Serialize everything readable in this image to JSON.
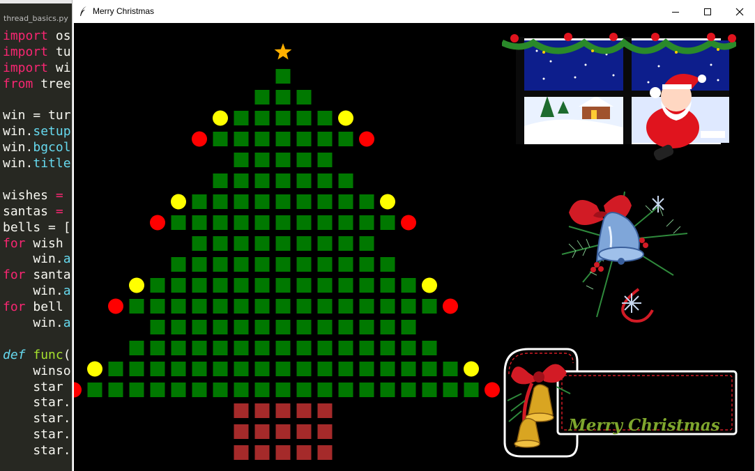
{
  "editor": {
    "tab_title": "thread_basics.py",
    "lines": [
      [
        [
          "kw",
          "import "
        ],
        [
          "wh",
          "os"
        ]
      ],
      [
        [
          "kw",
          "import "
        ],
        [
          "wh",
          "tu"
        ]
      ],
      [
        [
          "kw",
          "import "
        ],
        [
          "wh",
          "wi"
        ]
      ],
      [
        [
          "kw",
          "from "
        ],
        [
          "wh",
          "tree"
        ]
      ],
      [
        [
          "wh",
          ""
        ]
      ],
      [
        [
          "wh",
          "win = tur"
        ]
      ],
      [
        [
          "wh",
          "win."
        ],
        [
          "fn",
          "setup"
        ]
      ],
      [
        [
          "wh",
          "win."
        ],
        [
          "fn",
          "bgcol"
        ]
      ],
      [
        [
          "wh",
          "win."
        ],
        [
          "fn",
          "title"
        ]
      ],
      [
        [
          "wh",
          ""
        ]
      ],
      [
        [
          "wh",
          "wishes "
        ],
        [
          "kw",
          "="
        ]
      ],
      [
        [
          "wh",
          "santas "
        ],
        [
          "kw",
          "="
        ]
      ],
      [
        [
          "wh",
          "bells = ["
        ]
      ],
      [
        [
          "kw",
          "for "
        ],
        [
          "wh",
          "wish"
        ]
      ],
      [
        [
          "wh",
          "    win."
        ],
        [
          "fn",
          "a"
        ]
      ],
      [
        [
          "kw",
          "for "
        ],
        [
          "wh",
          "santa"
        ]
      ],
      [
        [
          "wh",
          "    win."
        ],
        [
          "fn",
          "a"
        ]
      ],
      [
        [
          "kw",
          "for "
        ],
        [
          "wh",
          "bell"
        ]
      ],
      [
        [
          "wh",
          "    win."
        ],
        [
          "fn",
          "a"
        ]
      ],
      [
        [
          "wh",
          ""
        ]
      ],
      [
        [
          "df",
          "def "
        ],
        [
          "nm",
          "func"
        ],
        [
          "wh",
          "("
        ]
      ],
      [
        [
          "wh",
          "    winso"
        ]
      ],
      [
        [
          "wh",
          "    star"
        ]
      ],
      [
        [
          "wh",
          "    star."
        ]
      ],
      [
        [
          "wh",
          "    star."
        ]
      ],
      [
        [
          "wh",
          "    star."
        ]
      ],
      [
        [
          "wh",
          "    star."
        ]
      ]
    ]
  },
  "window": {
    "title": "Merry Christmas",
    "controls": [
      "minimize",
      "maximize",
      "close"
    ]
  },
  "tree": {
    "colors": {
      "leaf": "#007800",
      "trunk": "#a52a2a",
      "yellow_ball": "#ffff00",
      "red_ball": "#ff0000",
      "star": "#ffb000"
    },
    "rows": [
      {
        "cells": 1,
        "balls": "none"
      },
      {
        "cells": 3,
        "balls": "none"
      },
      {
        "cells": 5,
        "balls": "yellow"
      },
      {
        "cells": 7,
        "balls": "red"
      },
      {
        "cells": 5,
        "balls": "none"
      },
      {
        "cells": 7,
        "balls": "none"
      },
      {
        "cells": 9,
        "balls": "yellow"
      },
      {
        "cells": 11,
        "balls": "red"
      },
      {
        "cells": 9,
        "balls": "none"
      },
      {
        "cells": 11,
        "balls": "none"
      },
      {
        "cells": 13,
        "balls": "yellow"
      },
      {
        "cells": 15,
        "balls": "red"
      },
      {
        "cells": 13,
        "balls": "none"
      },
      {
        "cells": 15,
        "balls": "none"
      },
      {
        "cells": 17,
        "balls": "yellow"
      },
      {
        "cells": 19,
        "balls": "red"
      }
    ],
    "trunk": {
      "cols": 5,
      "rows": 3
    }
  },
  "pictures": {
    "santa": "santa-window-picture",
    "bell": "holly-bell-picture",
    "banner_text": "Merry Christmas"
  }
}
